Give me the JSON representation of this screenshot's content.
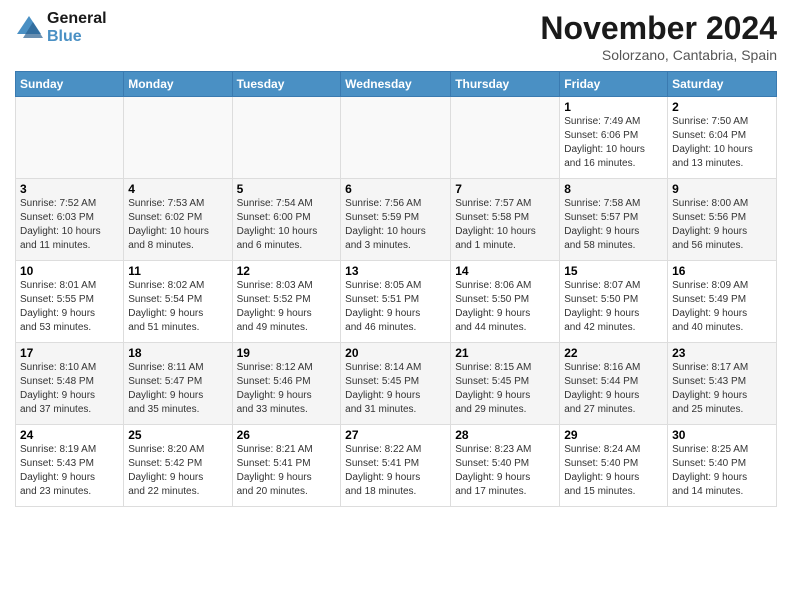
{
  "logo": {
    "line1": "General",
    "line2": "Blue"
  },
  "title": "November 2024",
  "location": "Solorzano, Cantabria, Spain",
  "weekdays": [
    "Sunday",
    "Monday",
    "Tuesday",
    "Wednesday",
    "Thursday",
    "Friday",
    "Saturday"
  ],
  "weeks": [
    [
      {
        "day": "",
        "info": ""
      },
      {
        "day": "",
        "info": ""
      },
      {
        "day": "",
        "info": ""
      },
      {
        "day": "",
        "info": ""
      },
      {
        "day": "",
        "info": ""
      },
      {
        "day": "1",
        "info": "Sunrise: 7:49 AM\nSunset: 6:06 PM\nDaylight: 10 hours\nand 16 minutes."
      },
      {
        "day": "2",
        "info": "Sunrise: 7:50 AM\nSunset: 6:04 PM\nDaylight: 10 hours\nand 13 minutes."
      }
    ],
    [
      {
        "day": "3",
        "info": "Sunrise: 7:52 AM\nSunset: 6:03 PM\nDaylight: 10 hours\nand 11 minutes."
      },
      {
        "day": "4",
        "info": "Sunrise: 7:53 AM\nSunset: 6:02 PM\nDaylight: 10 hours\nand 8 minutes."
      },
      {
        "day": "5",
        "info": "Sunrise: 7:54 AM\nSunset: 6:00 PM\nDaylight: 10 hours\nand 6 minutes."
      },
      {
        "day": "6",
        "info": "Sunrise: 7:56 AM\nSunset: 5:59 PM\nDaylight: 10 hours\nand 3 minutes."
      },
      {
        "day": "7",
        "info": "Sunrise: 7:57 AM\nSunset: 5:58 PM\nDaylight: 10 hours\nand 1 minute."
      },
      {
        "day": "8",
        "info": "Sunrise: 7:58 AM\nSunset: 5:57 PM\nDaylight: 9 hours\nand 58 minutes."
      },
      {
        "day": "9",
        "info": "Sunrise: 8:00 AM\nSunset: 5:56 PM\nDaylight: 9 hours\nand 56 minutes."
      }
    ],
    [
      {
        "day": "10",
        "info": "Sunrise: 8:01 AM\nSunset: 5:55 PM\nDaylight: 9 hours\nand 53 minutes."
      },
      {
        "day": "11",
        "info": "Sunrise: 8:02 AM\nSunset: 5:54 PM\nDaylight: 9 hours\nand 51 minutes."
      },
      {
        "day": "12",
        "info": "Sunrise: 8:03 AM\nSunset: 5:52 PM\nDaylight: 9 hours\nand 49 minutes."
      },
      {
        "day": "13",
        "info": "Sunrise: 8:05 AM\nSunset: 5:51 PM\nDaylight: 9 hours\nand 46 minutes."
      },
      {
        "day": "14",
        "info": "Sunrise: 8:06 AM\nSunset: 5:50 PM\nDaylight: 9 hours\nand 44 minutes."
      },
      {
        "day": "15",
        "info": "Sunrise: 8:07 AM\nSunset: 5:50 PM\nDaylight: 9 hours\nand 42 minutes."
      },
      {
        "day": "16",
        "info": "Sunrise: 8:09 AM\nSunset: 5:49 PM\nDaylight: 9 hours\nand 40 minutes."
      }
    ],
    [
      {
        "day": "17",
        "info": "Sunrise: 8:10 AM\nSunset: 5:48 PM\nDaylight: 9 hours\nand 37 minutes."
      },
      {
        "day": "18",
        "info": "Sunrise: 8:11 AM\nSunset: 5:47 PM\nDaylight: 9 hours\nand 35 minutes."
      },
      {
        "day": "19",
        "info": "Sunrise: 8:12 AM\nSunset: 5:46 PM\nDaylight: 9 hours\nand 33 minutes."
      },
      {
        "day": "20",
        "info": "Sunrise: 8:14 AM\nSunset: 5:45 PM\nDaylight: 9 hours\nand 31 minutes."
      },
      {
        "day": "21",
        "info": "Sunrise: 8:15 AM\nSunset: 5:45 PM\nDaylight: 9 hours\nand 29 minutes."
      },
      {
        "day": "22",
        "info": "Sunrise: 8:16 AM\nSunset: 5:44 PM\nDaylight: 9 hours\nand 27 minutes."
      },
      {
        "day": "23",
        "info": "Sunrise: 8:17 AM\nSunset: 5:43 PM\nDaylight: 9 hours\nand 25 minutes."
      }
    ],
    [
      {
        "day": "24",
        "info": "Sunrise: 8:19 AM\nSunset: 5:43 PM\nDaylight: 9 hours\nand 23 minutes."
      },
      {
        "day": "25",
        "info": "Sunrise: 8:20 AM\nSunset: 5:42 PM\nDaylight: 9 hours\nand 22 minutes."
      },
      {
        "day": "26",
        "info": "Sunrise: 8:21 AM\nSunset: 5:41 PM\nDaylight: 9 hours\nand 20 minutes."
      },
      {
        "day": "27",
        "info": "Sunrise: 8:22 AM\nSunset: 5:41 PM\nDaylight: 9 hours\nand 18 minutes."
      },
      {
        "day": "28",
        "info": "Sunrise: 8:23 AM\nSunset: 5:40 PM\nDaylight: 9 hours\nand 17 minutes."
      },
      {
        "day": "29",
        "info": "Sunrise: 8:24 AM\nSunset: 5:40 PM\nDaylight: 9 hours\nand 15 minutes."
      },
      {
        "day": "30",
        "info": "Sunrise: 8:25 AM\nSunset: 5:40 PM\nDaylight: 9 hours\nand 14 minutes."
      }
    ]
  ]
}
